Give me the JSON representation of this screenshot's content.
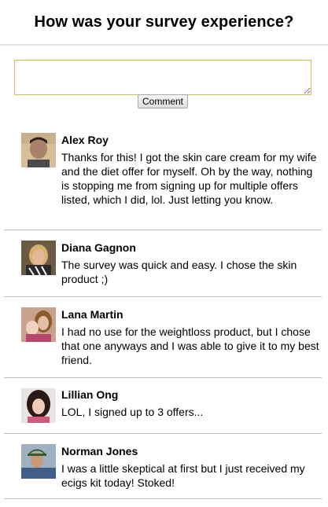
{
  "header": {
    "title": "How was your survey experience?"
  },
  "form": {
    "input_value": "",
    "button_label": "Comment"
  },
  "comments": [
    {
      "name": "Alex Roy",
      "text": "Thanks for this! I got the skin care cream for my wife and the diet offer for myself. Oh by the way, nothing is stopping me from signing up for multiple offers listed, which I did, lol. Just letting you know."
    },
    {
      "name": "Diana Gagnon",
      "text": "The survey was quick and easy. I chose the skin product ;)"
    },
    {
      "name": "Lana Martin",
      "text": "I had no use for the weightloss product, but I chose that one anyways and I was able to give it to my best friend."
    },
    {
      "name": "Lillian Ong",
      "text": "LOL, I signed up to 3 offers..."
    },
    {
      "name": "Norman Jones",
      "text": "I was a little skeptical at first but I just received my ecigs kit today! Stoked!"
    }
  ]
}
